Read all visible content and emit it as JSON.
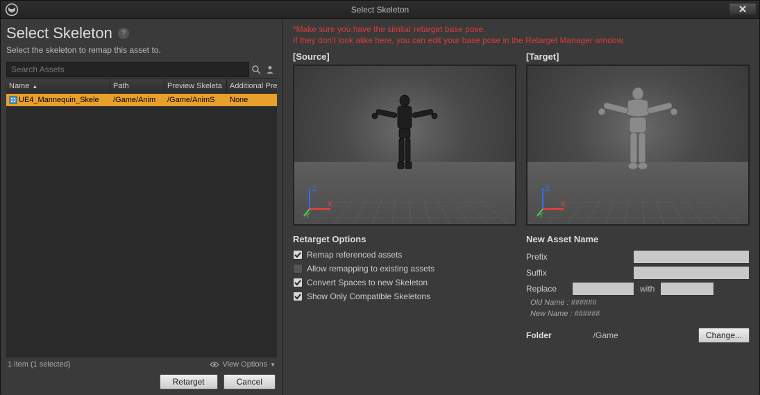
{
  "titlebar": {
    "title": "Select Skeleton"
  },
  "left": {
    "heading": "Select Skeleton",
    "subheading": "Select the skeleton to remap this asset to.",
    "search_placeholder": "Search Assets",
    "columns": {
      "name": "Name",
      "path": "Path",
      "preview": "Preview Skeleta",
      "additional": "Additional Prev"
    },
    "rows": [
      {
        "name": "UE4_Mannequin_Skele",
        "path": "/Game/Anim",
        "preview": "/Game/AnimS",
        "additional": "None"
      }
    ],
    "status": "1 item (1 selected)",
    "view_options": "View Options",
    "retarget_btn": "Retarget",
    "cancel_btn": "Cancel"
  },
  "right": {
    "warning_line1": "*Make sure you have the similar retarget base pose.",
    "warning_line2": "If they don't look alike here, you can edit your base pose in the Retarget Manager window.",
    "source_label": "[Source]",
    "target_label": "[Target]",
    "retarget_options_title": "Retarget Options",
    "options": {
      "remap": {
        "label": "Remap referenced assets",
        "checked": true
      },
      "allow": {
        "label": "Allow remapping to existing assets",
        "checked": false
      },
      "convert": {
        "label": "Convert Spaces to new Skeleton",
        "checked": true
      },
      "show_compat": {
        "label": "Show Only Compatible Skeletons",
        "checked": true
      }
    },
    "new_asset_title": "New Asset Name",
    "prefix_label": "Prefix",
    "suffix_label": "Suffix",
    "replace_label": "Replace",
    "with_label": "with",
    "old_name": "Old Name : ######",
    "new_name": "New Name : ######",
    "folder_label": "Folder",
    "folder_value": "/Game",
    "change_btn": "Change..."
  }
}
